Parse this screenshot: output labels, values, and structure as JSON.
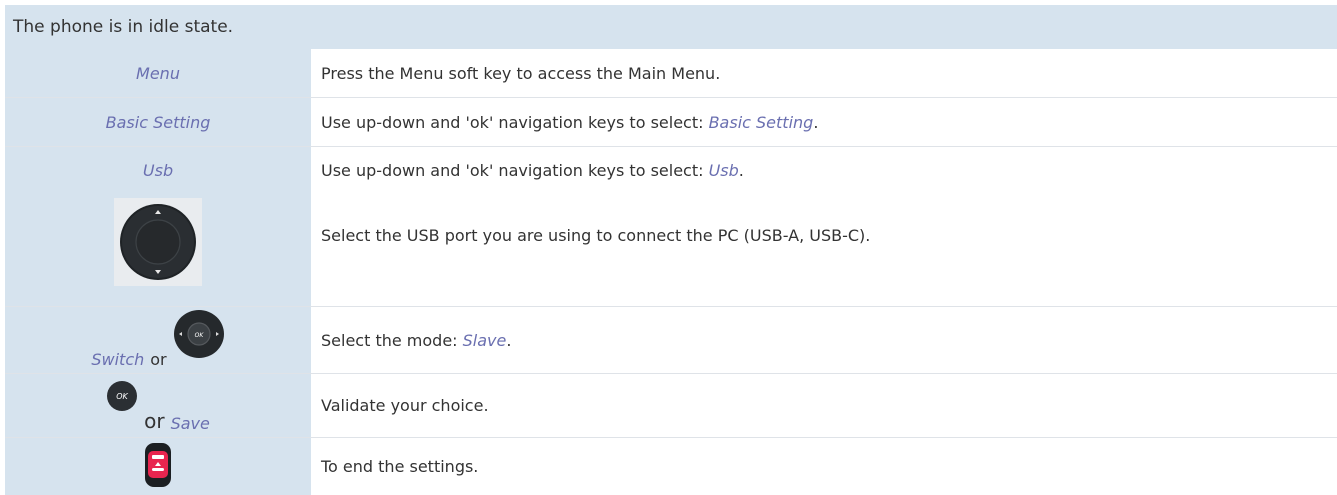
{
  "header": {
    "text": "The phone is in idle state."
  },
  "rows": [
    {
      "key": "Menu",
      "desc": "Press the Menu soft key to access the Main Menu."
    },
    {
      "key": "Basic Setting",
      "desc_prefix": "Use up-down and 'ok' navigation keys to select: ",
      "desc_kw": "Basic Setting",
      "desc_suffix": "."
    },
    {
      "key": "Usb",
      "desc_prefix": "Use up-down and 'ok' navigation keys to select: ",
      "desc_kw": "Usb",
      "desc_suffix": ".",
      "desc_line2": "Select the USB port you are using to connect the PC (USB-A, USB-C)."
    },
    {
      "key": "Switch",
      "or": "or",
      "desc_prefix": "Select the mode: ",
      "desc_kw": "Slave",
      "desc_suffix": "."
    },
    {
      "or": "or",
      "key": "Save",
      "desc": "Validate your choice.",
      "ok_label": "OK"
    },
    {
      "desc": "To end the settings."
    }
  ],
  "colors": {
    "header_bg": "#d6e3ee",
    "keyword": "#6a6fb0",
    "text": "#333333",
    "hangup": "#e8254f"
  },
  "icons": [
    "nav-updown-icon",
    "nav-ok-icon",
    "ok-key-icon",
    "hangup-key-icon"
  ]
}
